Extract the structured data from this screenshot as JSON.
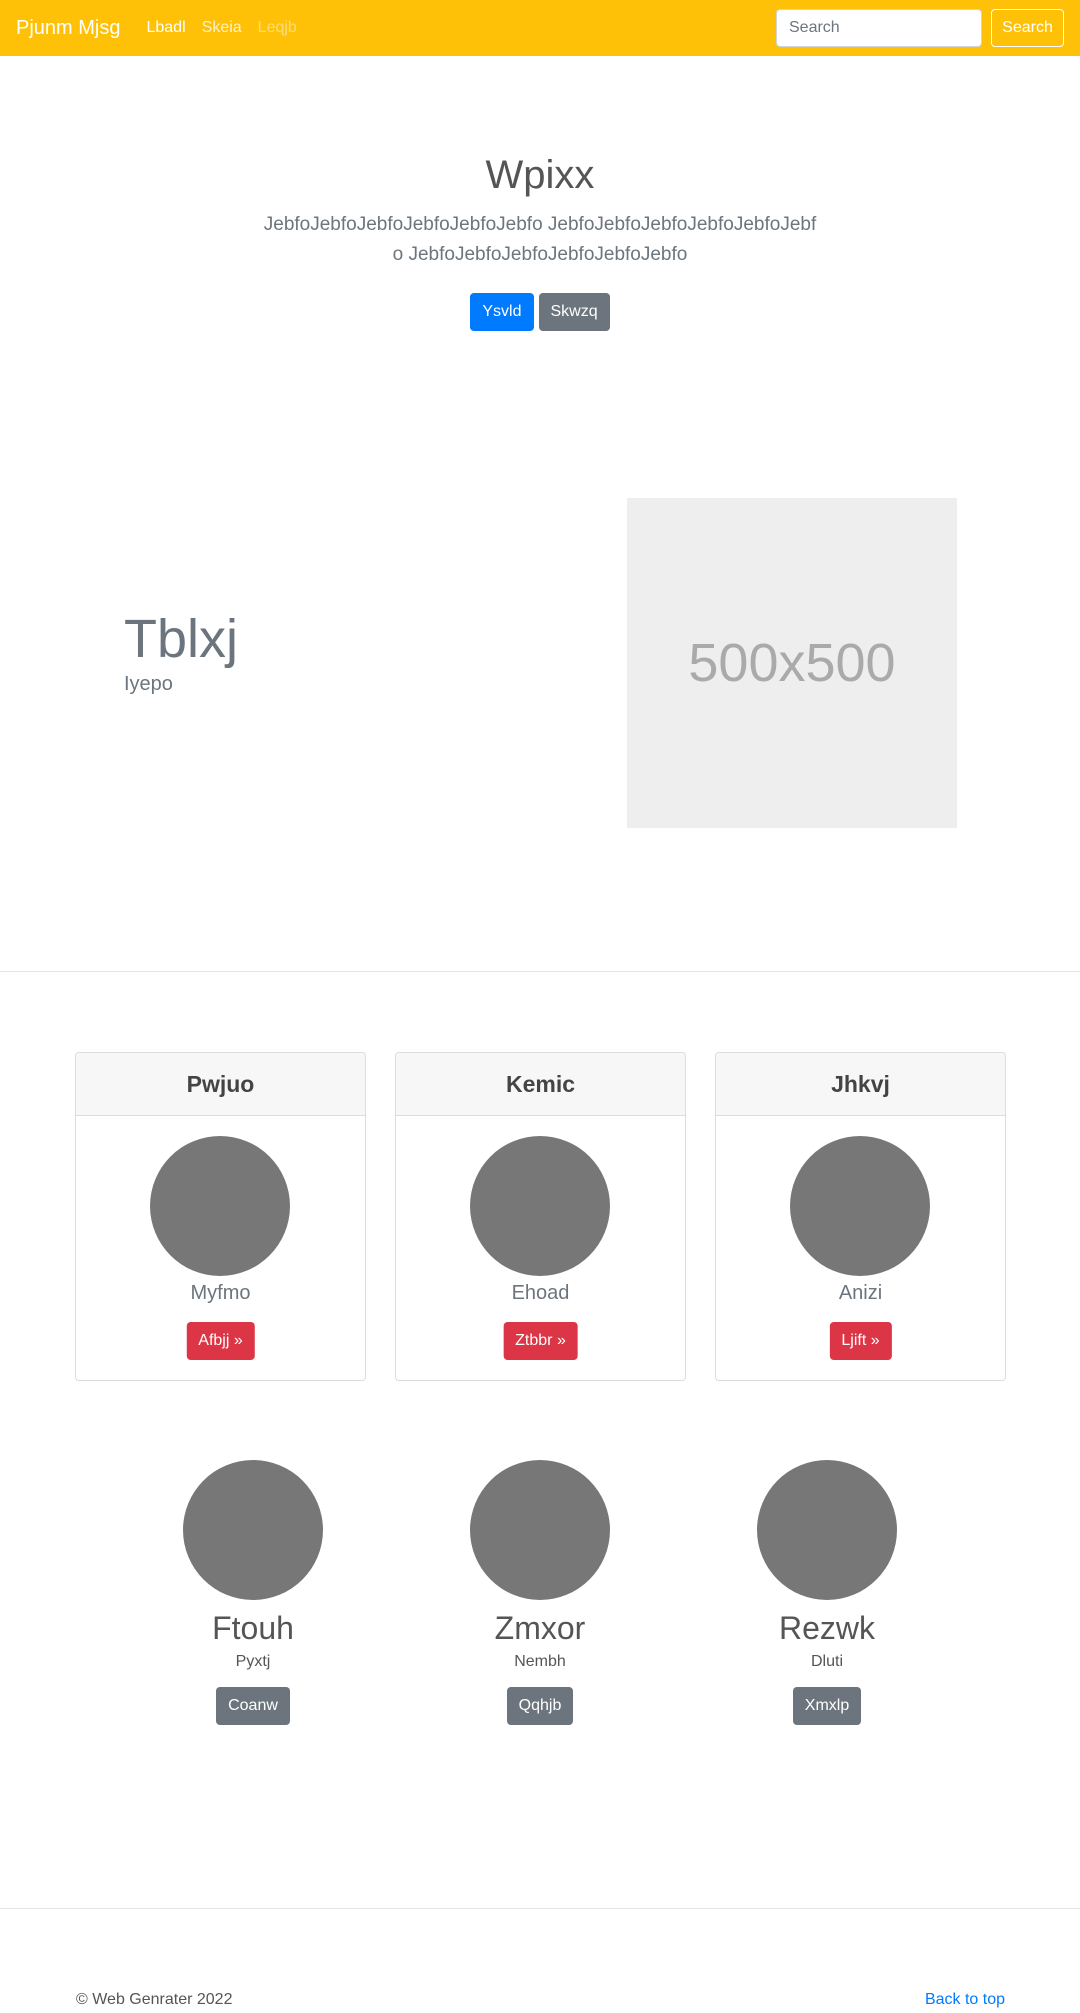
{
  "navbar": {
    "brand": "Pjunm Mjsg",
    "links": [
      {
        "label": "Lbadl",
        "state": "active"
      },
      {
        "label": "Skeia",
        "state": "normal"
      },
      {
        "label": "Leqjb",
        "state": "disabled"
      }
    ],
    "search_placeholder": "Search",
    "search_button": "Search"
  },
  "hero": {
    "title": "Wpixx",
    "lead": "JebfoJebfoJebfoJebfoJebfoJebfo JebfoJebfoJebfoJebfoJebfoJebfo JebfoJebfoJebfoJebfoJebfoJebfo",
    "primary_button": "Ysvld",
    "secondary_button": "Skwzq"
  },
  "feature": {
    "heading": "Tblxj",
    "subheading": "Iyepo",
    "image_label": "500x500"
  },
  "cards": [
    {
      "header": "Pwjuo",
      "text": "Myfmo",
      "button": "Afbjj »"
    },
    {
      "header": "Kemic",
      "text": "Ehoad",
      "button": "Ztbbr »"
    },
    {
      "header": "Jhkvj",
      "text": "Anizi",
      "button": "Ljift »"
    }
  ],
  "people": [
    {
      "name": "Ftouh",
      "text": "Pyxtj",
      "button": "Coanw"
    },
    {
      "name": "Zmxor",
      "text": "Nembh",
      "button": "Qqhjb"
    },
    {
      "name": "Rezwk",
      "text": "Dluti",
      "button": "Xmxlp"
    }
  ],
  "footer": {
    "copyright": "© Web Genrater 2022",
    "back_to_top": "Back to top"
  },
  "colors": {
    "navbar": "#ffc107",
    "primary": "#007bff",
    "secondary": "#6c757d",
    "danger": "#dc3545",
    "avatar": "#777777"
  }
}
